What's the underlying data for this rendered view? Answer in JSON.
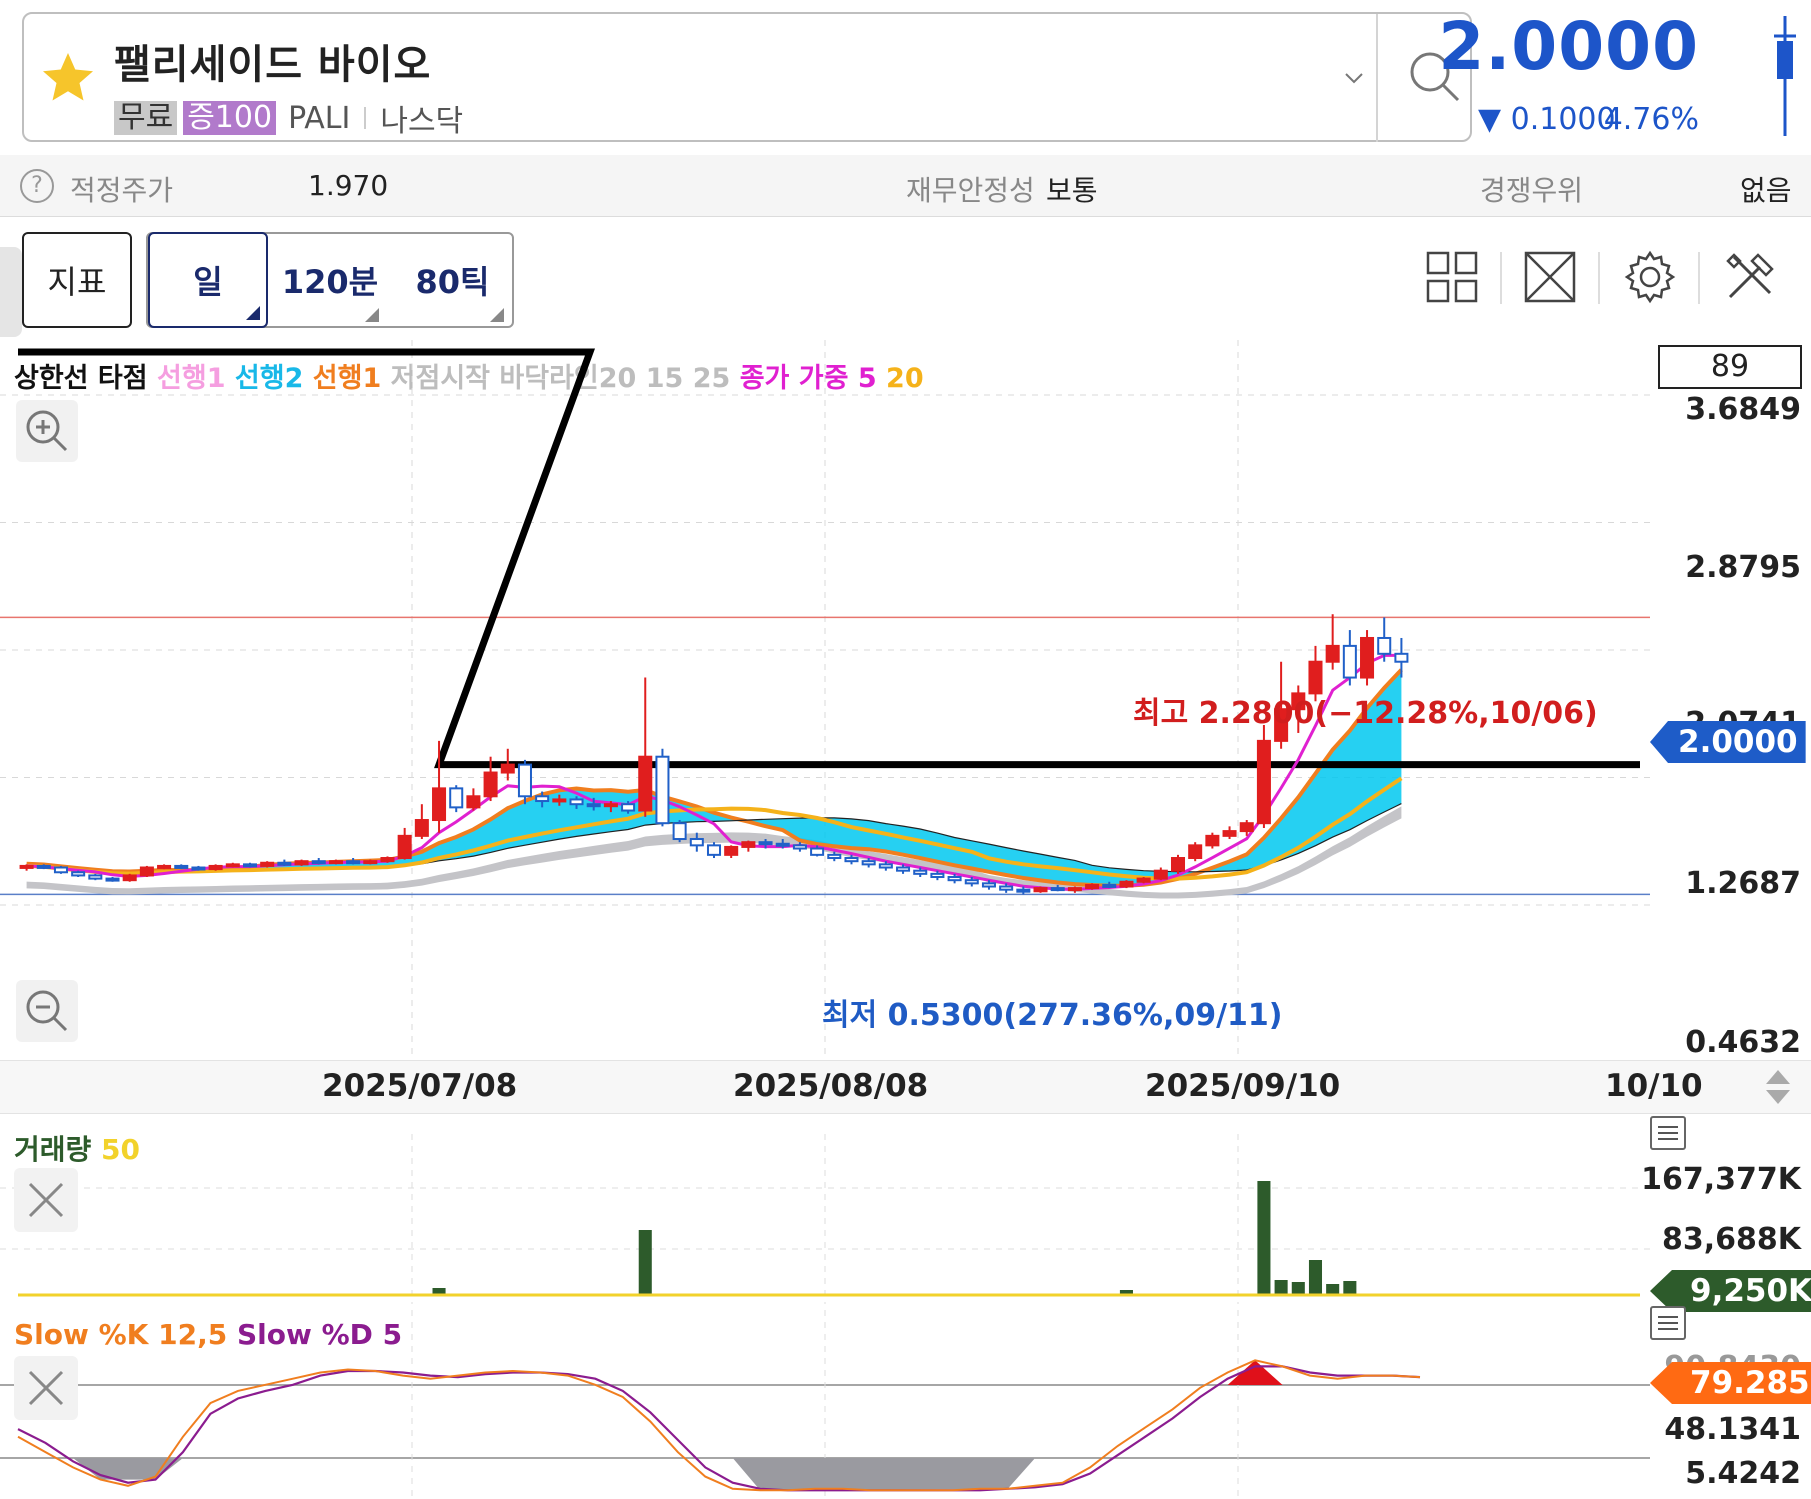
{
  "header": {
    "stock_name": "팰리세이드 바이오",
    "tag_free": "무료",
    "tag_margin": "증100",
    "ticker": "PALI",
    "exchange": "나스닥",
    "price": "2.0000",
    "change": "▼ 0.1000",
    "change_pct": "4.76%",
    "accent_color": "#1d55c9"
  },
  "info_bar": {
    "fair_price_label": "적정주가",
    "fair_price_value": "1.970",
    "stability_label": "재무안정성",
    "stability_value": "보통",
    "competitive_label": "경쟁우위",
    "competitive_value": "없음"
  },
  "toolbar": {
    "indicator_label": "지표",
    "day_label": "일",
    "min120_label": "120분",
    "tick80_label": "80틱",
    "icons": [
      "grid-layout-icon",
      "fullscreen-icon",
      "settings-gear-icon",
      "tools-icon"
    ]
  },
  "main_chart": {
    "count_box": "89",
    "legend": [
      {
        "text": "상한선 타점",
        "color": "#111111"
      },
      {
        "text": "선행1",
        "color": "#f59ee0"
      },
      {
        "text": "선행2",
        "color": "#18b8e8"
      },
      {
        "text": "선행1",
        "color": "#f07e1f"
      },
      {
        "text": "저점시작 바닥라인20 15 25",
        "color": "#bdbdbd"
      },
      {
        "text": "종가 가중 5",
        "color": "#e020d0"
      },
      {
        "text": "20",
        "color": "#f5b21a"
      }
    ],
    "y_axis": [
      "3.6849",
      "2.8795",
      "2.0741",
      "1.2687",
      "0.4632"
    ],
    "current_price_tag": "2.0000",
    "high_annotation": "최고 2.2800(−12.28%,10/06)",
    "low_annotation": "최저 0.5300(277.36%,09/11)",
    "dates": [
      "2025/07/08",
      "2025/08/08",
      "2025/09/10",
      "10/10"
    ]
  },
  "volume_panel": {
    "title": "거래량",
    "title_param": "50",
    "y_axis": [
      "167,377K",
      "83,688K"
    ],
    "current_tag": "9,250K"
  },
  "stoch_panel": {
    "title_k": "Slow %K 12,5",
    "title_d": "Slow %D 5",
    "y_axis_top": "90.8430",
    "y_axis": [
      "48.1341",
      "5.4242"
    ],
    "current_tag": "79.2852"
  },
  "chart_data": {
    "type": "candlestick",
    "y_range": [
      0.4632,
      3.6849
    ],
    "high": 2.28,
    "low": 0.53,
    "last": 2.0,
    "candles": [
      [
        0.7,
        0.72,
        0.68,
        0.71
      ],
      [
        0.71,
        0.72,
        0.69,
        0.7
      ],
      [
        0.7,
        0.71,
        0.66,
        0.67
      ],
      [
        0.67,
        0.68,
        0.64,
        0.65
      ],
      [
        0.65,
        0.66,
        0.62,
        0.63
      ],
      [
        0.63,
        0.64,
        0.61,
        0.62
      ],
      [
        0.62,
        0.66,
        0.61,
        0.65
      ],
      [
        0.65,
        0.71,
        0.64,
        0.7
      ],
      [
        0.7,
        0.72,
        0.69,
        0.71
      ],
      [
        0.71,
        0.72,
        0.69,
        0.7
      ],
      [
        0.7,
        0.71,
        0.68,
        0.69
      ],
      [
        0.69,
        0.72,
        0.68,
        0.71
      ],
      [
        0.71,
        0.73,
        0.7,
        0.72
      ],
      [
        0.72,
        0.73,
        0.7,
        0.71
      ],
      [
        0.71,
        0.74,
        0.7,
        0.73
      ],
      [
        0.73,
        0.75,
        0.71,
        0.72
      ],
      [
        0.72,
        0.75,
        0.71,
        0.74
      ],
      [
        0.74,
        0.76,
        0.72,
        0.73
      ],
      [
        0.73,
        0.75,
        0.72,
        0.74
      ],
      [
        0.74,
        0.76,
        0.72,
        0.73
      ],
      [
        0.73,
        0.75,
        0.72,
        0.74
      ],
      [
        0.74,
        0.77,
        0.73,
        0.76
      ],
      [
        0.76,
        0.95,
        0.75,
        0.9
      ],
      [
        0.9,
        1.1,
        0.88,
        1.0
      ],
      [
        1.0,
        1.5,
        0.92,
        1.2
      ],
      [
        1.2,
        1.22,
        1.05,
        1.08
      ],
      [
        1.08,
        1.2,
        1.06,
        1.15
      ],
      [
        1.15,
        1.4,
        1.12,
        1.3
      ],
      [
        1.3,
        1.45,
        1.25,
        1.35
      ],
      [
        1.35,
        1.38,
        1.1,
        1.15
      ],
      [
        1.15,
        1.18,
        1.08,
        1.12
      ],
      [
        1.12,
        1.16,
        1.09,
        1.13
      ],
      [
        1.13,
        1.15,
        1.07,
        1.1
      ],
      [
        1.1,
        1.14,
        1.06,
        1.09
      ],
      [
        1.09,
        1.12,
        1.05,
        1.1
      ],
      [
        1.1,
        1.12,
        1.04,
        1.06
      ],
      [
        1.06,
        1.9,
        1.02,
        1.4
      ],
      [
        1.4,
        1.45,
        0.96,
        0.98
      ],
      [
        0.98,
        1.0,
        0.86,
        0.88
      ],
      [
        0.88,
        0.92,
        0.8,
        0.84
      ],
      [
        0.84,
        0.86,
        0.76,
        0.78
      ],
      [
        0.78,
        0.84,
        0.76,
        0.83
      ],
      [
        0.83,
        0.87,
        0.8,
        0.86
      ],
      [
        0.86,
        0.88,
        0.82,
        0.85
      ],
      [
        0.85,
        0.88,
        0.82,
        0.84
      ],
      [
        0.84,
        0.86,
        0.8,
        0.82
      ],
      [
        0.82,
        0.84,
        0.77,
        0.78
      ],
      [
        0.78,
        0.8,
        0.74,
        0.76
      ],
      [
        0.76,
        0.78,
        0.72,
        0.74
      ],
      [
        0.74,
        0.76,
        0.7,
        0.72
      ],
      [
        0.72,
        0.74,
        0.68,
        0.7
      ],
      [
        0.7,
        0.72,
        0.66,
        0.68
      ],
      [
        0.68,
        0.7,
        0.64,
        0.66
      ],
      [
        0.66,
        0.68,
        0.62,
        0.64
      ],
      [
        0.64,
        0.66,
        0.6,
        0.62
      ],
      [
        0.62,
        0.64,
        0.58,
        0.6
      ],
      [
        0.6,
        0.62,
        0.56,
        0.58
      ],
      [
        0.58,
        0.6,
        0.54,
        0.56
      ],
      [
        0.56,
        0.58,
        0.53,
        0.55
      ],
      [
        0.55,
        0.58,
        0.54,
        0.57
      ],
      [
        0.57,
        0.59,
        0.55,
        0.56
      ],
      [
        0.56,
        0.58,
        0.54,
        0.57
      ],
      [
        0.57,
        0.6,
        0.56,
        0.59
      ],
      [
        0.59,
        0.61,
        0.57,
        0.58
      ],
      [
        0.58,
        0.62,
        0.57,
        0.61
      ],
      [
        0.61,
        0.64,
        0.6,
        0.63
      ],
      [
        0.63,
        0.7,
        0.62,
        0.68
      ],
      [
        0.68,
        0.78,
        0.66,
        0.76
      ],
      [
        0.76,
        0.86,
        0.74,
        0.84
      ],
      [
        0.84,
        0.92,
        0.82,
        0.9
      ],
      [
        0.9,
        0.96,
        0.88,
        0.93
      ],
      [
        0.93,
        1.0,
        0.9,
        0.98
      ],
      [
        0.98,
        1.6,
        0.95,
        1.5
      ],
      [
        1.5,
        2.0,
        1.45,
        1.7
      ],
      [
        1.7,
        1.85,
        1.55,
        1.8
      ],
      [
        1.8,
        2.1,
        1.75,
        2.0
      ],
      [
        2.0,
        2.3,
        1.95,
        2.1
      ],
      [
        2.1,
        2.2,
        1.85,
        1.9
      ],
      [
        1.9,
        2.2,
        1.85,
        2.15
      ],
      [
        2.15,
        2.28,
        2.0,
        2.05
      ],
      [
        2.05,
        2.15,
        1.9,
        2.0
      ]
    ]
  }
}
